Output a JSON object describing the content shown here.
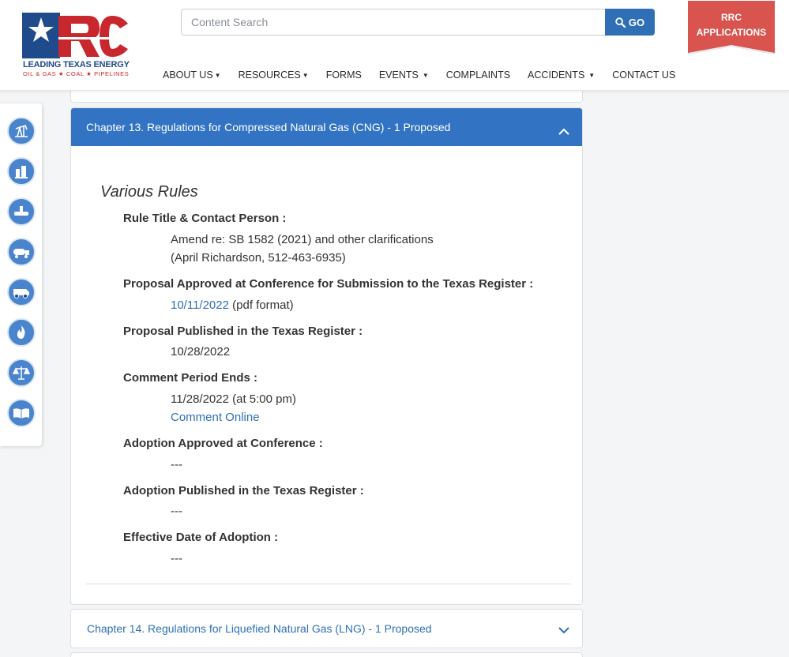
{
  "logo": {
    "tagline": "LEADING TEXAS ENERGY",
    "subline": "OIL & GAS ★ COAL ★ PIPELINES"
  },
  "search": {
    "placeholder": "Content Search",
    "button_label": "GO"
  },
  "nav": [
    {
      "label": "ABOUT US",
      "dropdown": true
    },
    {
      "label": "RESOURCES",
      "dropdown": true
    },
    {
      "label": "FORMS",
      "dropdown": false
    },
    {
      "label": "EVENTS",
      "dropdown": true
    },
    {
      "label": "COMPLAINTS",
      "dropdown": false
    },
    {
      "label": "ACCIDENTS",
      "dropdown": true
    },
    {
      "label": "CONTACT US",
      "dropdown": false
    }
  ],
  "apps_button": {
    "line1": "RRC",
    "line2": "APPLICATIONS"
  },
  "rail_icons": [
    "oil-pump-icon",
    "refinery-icon",
    "pipeline-icon",
    "tanker-truck-icon",
    "mining-truck-icon",
    "flame-icon",
    "justice-scale-icon",
    "open-book-icon"
  ],
  "panel": {
    "title": "Chapter 13. Regulations for Compressed Natural Gas (CNG) - 1 Proposed",
    "section_heading": "Various Rules",
    "fields": {
      "rule_title_label": "Rule Title & Contact Person :",
      "rule_title_line1": "Amend re: SB 1582 (2021) and other clarifications",
      "rule_title_line2": "(April Richardson, 512-463-6935)",
      "proposal_approved_label": "Proposal Approved at Conference for Submission to the Texas Register :",
      "proposal_approved_link": "10/11/2022",
      "proposal_approved_suffix": " (pdf format)",
      "proposal_published_label": "Proposal Published in the Texas Register :",
      "proposal_published_value": "10/28/2022",
      "comment_period_label": "Comment Period Ends :",
      "comment_period_value": "11/28/2022 (at 5:00 pm)",
      "comment_online_link": "Comment Online",
      "adoption_approved_label": "Adoption Approved at Conference :",
      "adoption_approved_value": "---",
      "adoption_published_label": "Adoption Published in the Texas Register :",
      "adoption_published_value": "---",
      "effective_date_label": "Effective Date of Adoption :",
      "effective_date_value": "---"
    }
  },
  "next_panel": {
    "title": "Chapter 14. Regulations for Liquefied Natural Gas (LNG) - 1 Proposed"
  },
  "colors": {
    "brand_blue": "#3373c4",
    "link_blue": "#2f6fb5",
    "apps_red": "#d9534f"
  }
}
